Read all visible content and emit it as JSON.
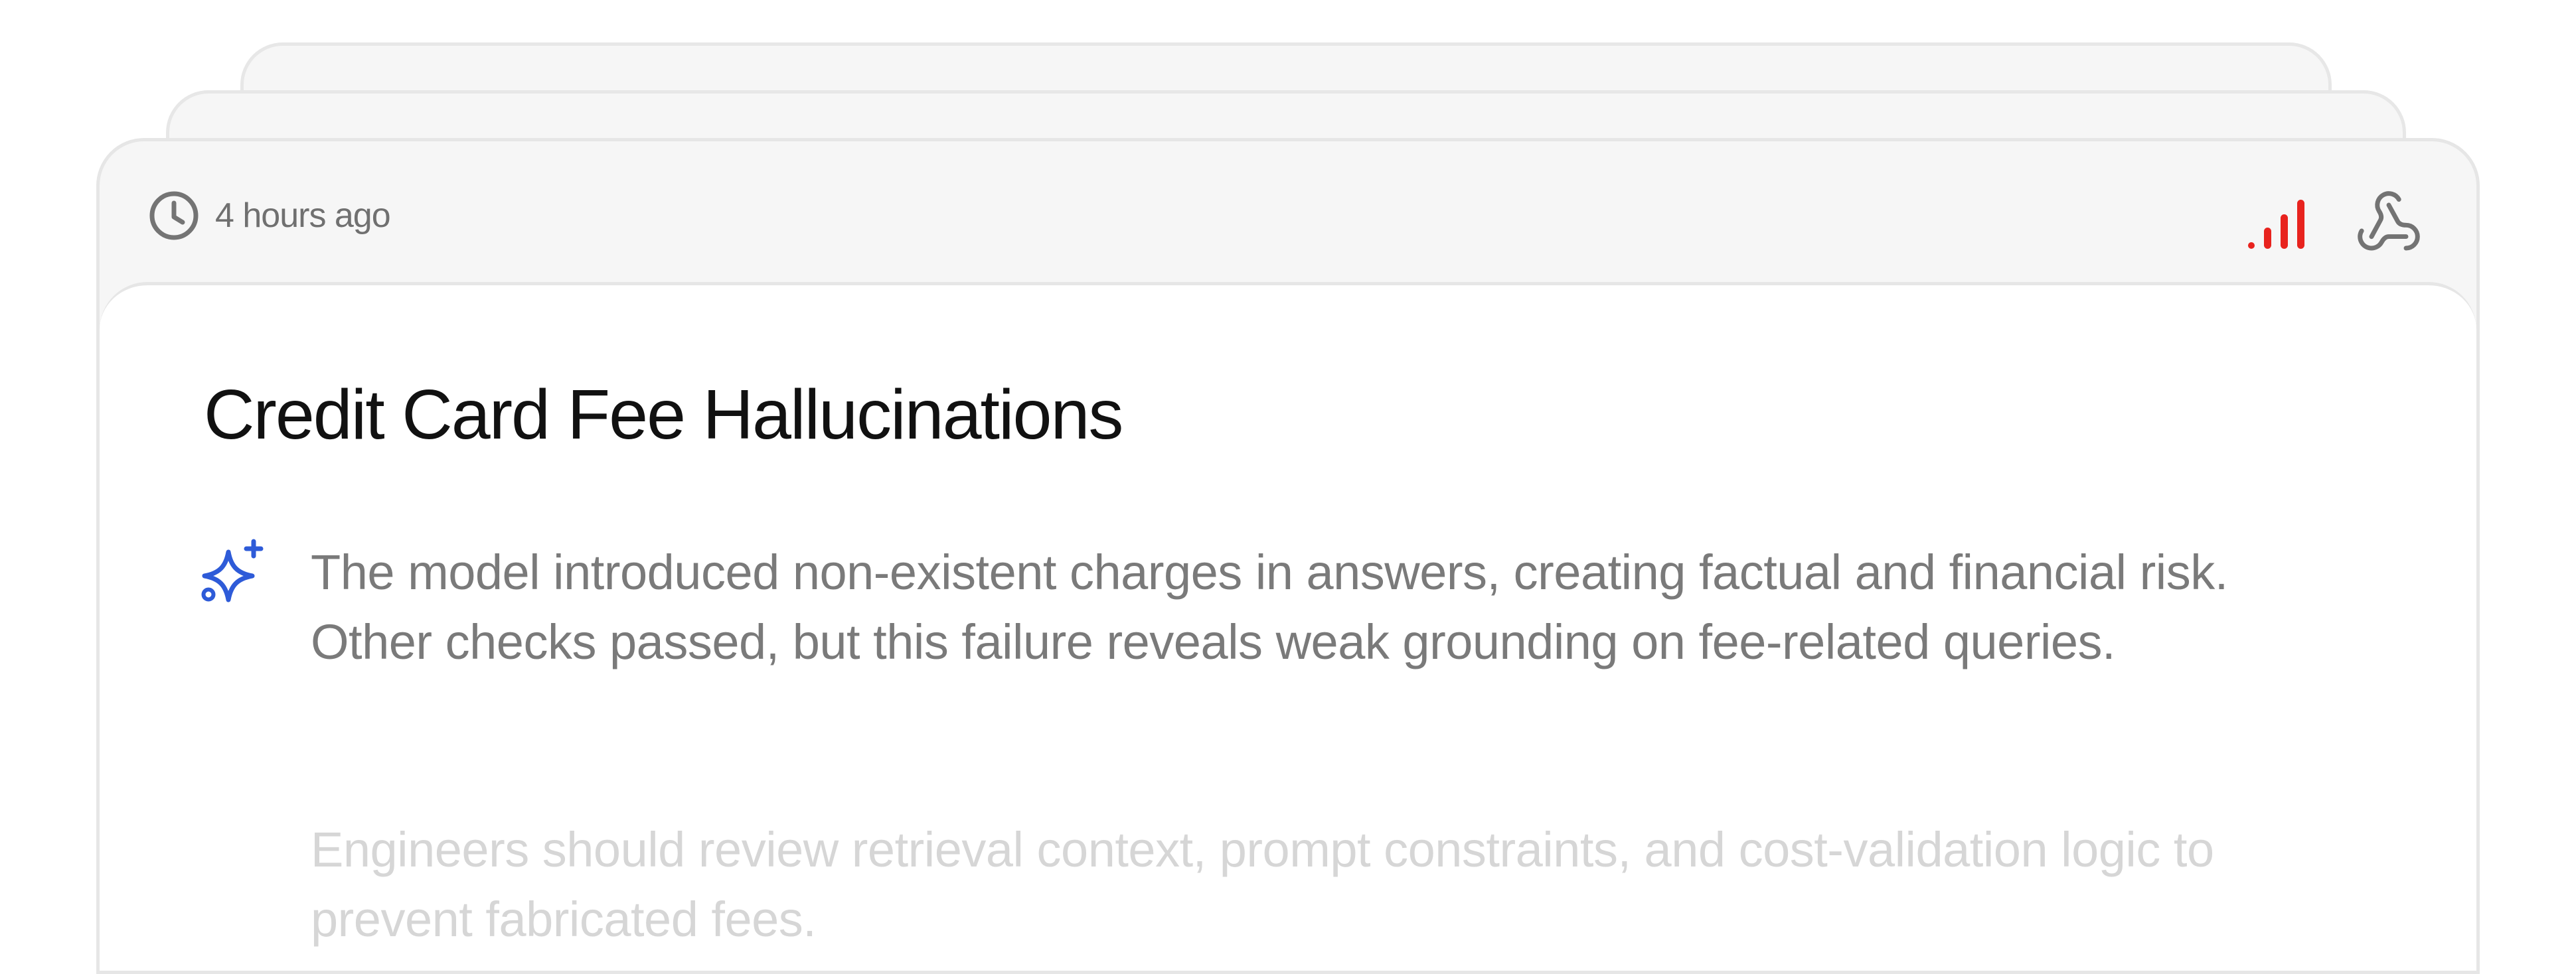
{
  "header": {
    "timestamp": "4 hours ago",
    "time_icon": "clock-icon",
    "signal_icon": "signal-strength-icon",
    "signal_color": "#e8231e",
    "integration_icon": "webhook-icon"
  },
  "issue": {
    "title": "Credit Card Fee Hallucinations",
    "summary_icon": "sparkle-icon",
    "summary_icon_color": "#2e5bd8",
    "summary": "The model introduced non-existent charges in answers, creating factual and financial risk. Other checks passed, but this failure reveals weak grounding on fee-related queries.",
    "recommendation": "Engineers should review retrieval context, prompt constraints, and cost-validation logic to prevent fabricated fees."
  }
}
